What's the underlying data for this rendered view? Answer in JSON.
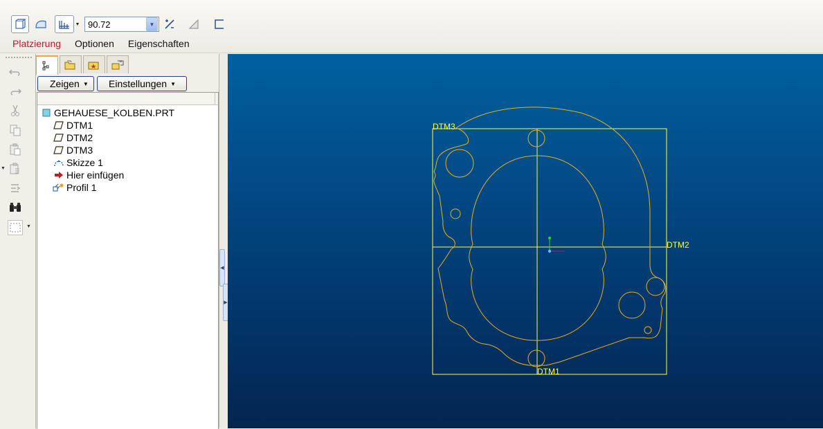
{
  "dashboard": {
    "depth_value": "90.72",
    "tabs": [
      {
        "label": "Platzierung",
        "active": true
      },
      {
        "label": "Optionen",
        "active": false
      },
      {
        "label": "Eigenschaften",
        "active": false
      }
    ]
  },
  "navigator": {
    "show_button": "Zeigen",
    "settings_button": "Einstellungen",
    "tree": [
      {
        "label": "GEHAUESE_KOLBEN.PRT",
        "icon": "part-icon"
      },
      {
        "label": "DTM1",
        "icon": "datum-plane-icon"
      },
      {
        "label": "DTM2",
        "icon": "datum-plane-icon"
      },
      {
        "label": "DTM3",
        "icon": "datum-plane-icon"
      },
      {
        "label": "Skizze 1",
        "icon": "sketch-icon"
      },
      {
        "label": "Hier einfügen",
        "icon": "insert-arrow-icon"
      },
      {
        "label": "Profil 1",
        "icon": "extrude-feature-icon"
      }
    ]
  },
  "viewport": {
    "datum_labels": {
      "dtm1": "DTM1",
      "dtm2": "DTM2",
      "dtm3": "DTM3"
    }
  },
  "colors": {
    "active_tab": "#c8102e",
    "datum": "#ffff33",
    "sketch": "#e8b21a",
    "background_top": "#00609e",
    "background_bottom": "#042550"
  }
}
